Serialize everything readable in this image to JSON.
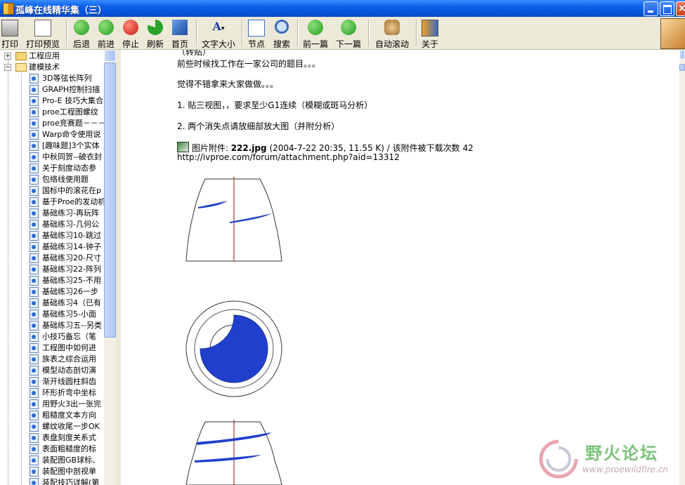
{
  "window": {
    "title": "孤峰在线精华集（三）"
  },
  "toolbar": {
    "print": "打印",
    "print_preview": "打印预览",
    "back": "后退",
    "forward": "前进",
    "stop": "停止",
    "refresh": "刷新",
    "home": "首页",
    "font_size": "文字大小",
    "nodes": "节点",
    "search": "搜索",
    "prev_article": "前一篇",
    "next_article": "下一篇",
    "auto_scroll": "自动滚动",
    "about": "关于"
  },
  "tree": {
    "folders": [
      {
        "label": "工程应用",
        "expanded": false
      },
      {
        "label": "建模技术",
        "expanded": true
      }
    ],
    "items": [
      "3D等弦长阵列",
      "GRAPH控制扫描",
      "Pro-E 技巧大集合",
      "proe工程图螺纹",
      "proe竞赛题－－－",
      "Warp命令使用说",
      "[趣味题]3个实体",
      "中秋同贺--破衣封",
      "关于刻度动态参",
      "包络线使用题",
      "国标中的滚花在p",
      "基于Proe的发动机",
      "基础练习-再玩阵",
      "基础练习-几何公",
      "基础练习10-跳过",
      "基础练习14-钟子",
      "基础练习20-尺寸",
      "基础练习22-阵列",
      "基础练习25-不用",
      "基础练习26一步",
      "基础练习4（已有",
      "基础练习5-小面",
      "基础练习五--另类",
      "小技巧备忘（笔",
      "工程图中如何进",
      "族表之综合运用",
      "模型动态剖切演",
      "渐开线圆柱斜齿",
      "环形折弯中坐标",
      "用野火3出一张完",
      "粗糙度文本方向",
      "螺纹收尾一步OK",
      "表盘刻度关系式",
      "表面粗糙度的标",
      "装配图GB球标、",
      "装配图中剖视单",
      "装配技巧详解(第"
    ]
  },
  "content": {
    "top_cut": "（转贴）",
    "p1": "前些时候找工作在一家公司的题目。。。",
    "p2": "觉得不错拿来大家做做。。。",
    "p3": "1. 贴三视图，，要求至少G1连续（模糊或斑马分析）",
    "p4": "2. 两个消失点请放细部放大图（并附分析）",
    "attachment_prefix": "图片附件:",
    "attachment_name": "222.jpg",
    "attachment_info": "(2004-7-22 20:35, 11.55 K) / 该附件被下载次数 42",
    "attachment_url": "http://ivproe.com/forum/attachment.php?aid=13312"
  },
  "watermark": {
    "title": "野火论坛",
    "url": "www.proewildfire.cn"
  },
  "colors": {
    "title_bar": "#0A5FE8",
    "accent_blue": "#1F3FCC",
    "axis_red": "#A01010",
    "watermark_green": "#7CC27A"
  }
}
